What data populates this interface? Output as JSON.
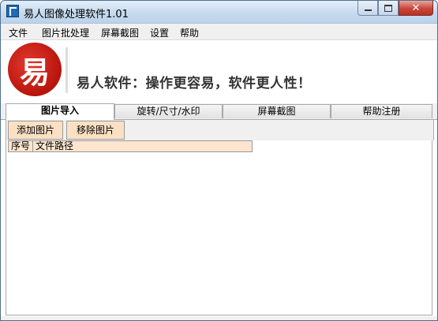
{
  "window": {
    "title": "易人图像处理软件1.01"
  },
  "caption_buttons": {
    "minimize": "minimize",
    "maximize": "maximize",
    "close": "✕"
  },
  "menu": [
    "文件",
    "图片批处理",
    "屏幕截图",
    "设置",
    "帮助"
  ],
  "banner": {
    "logo_char": "易",
    "slogan": "易人软件：操作更容易，软件更人性！"
  },
  "tabs": [
    {
      "label": "图片导入",
      "active": true
    },
    {
      "label": "旋转/尺寸/水印",
      "active": false
    },
    {
      "label": "屏幕截图",
      "active": false
    },
    {
      "label": "帮助注册",
      "active": false
    }
  ],
  "toolbar": {
    "add_label": "添加图片",
    "remove_label": "移除图片"
  },
  "list": {
    "columns": [
      "序号",
      "文件路径"
    ]
  },
  "colors": {
    "button_bg": "#fbe0c4",
    "header_bg": "#fde5cf",
    "logo_red": "#c4170f"
  }
}
